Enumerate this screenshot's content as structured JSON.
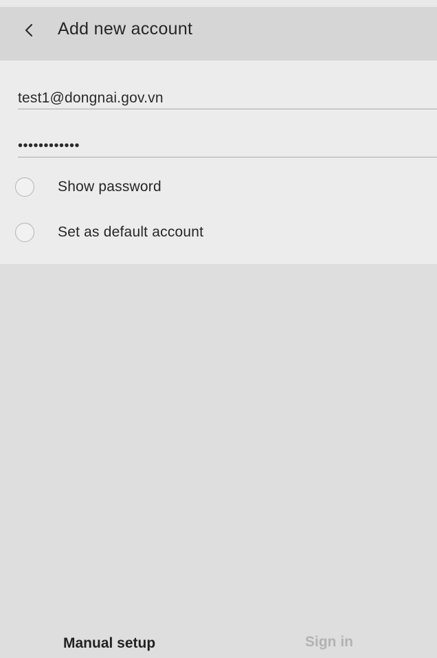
{
  "header": {
    "title": "Add new account",
    "back_icon": "chevron-left-icon"
  },
  "form": {
    "email": {
      "value": "test1@dongnai.gov.vn",
      "placeholder": ""
    },
    "password": {
      "masked_value": "••••••••••••",
      "placeholder": ""
    },
    "options": {
      "show_password": {
        "label": "Show password",
        "checked": false
      },
      "default_account": {
        "label": "Set as default account",
        "checked": false
      }
    }
  },
  "footer": {
    "manual_setup_label": "Manual setup",
    "sign_in_label": "Sign in",
    "sign_in_enabled": false
  },
  "colors": {
    "background": "#dedede",
    "card": "#ececec",
    "header": "#d6d6d6",
    "disabled_text": "#b2b2b2"
  }
}
